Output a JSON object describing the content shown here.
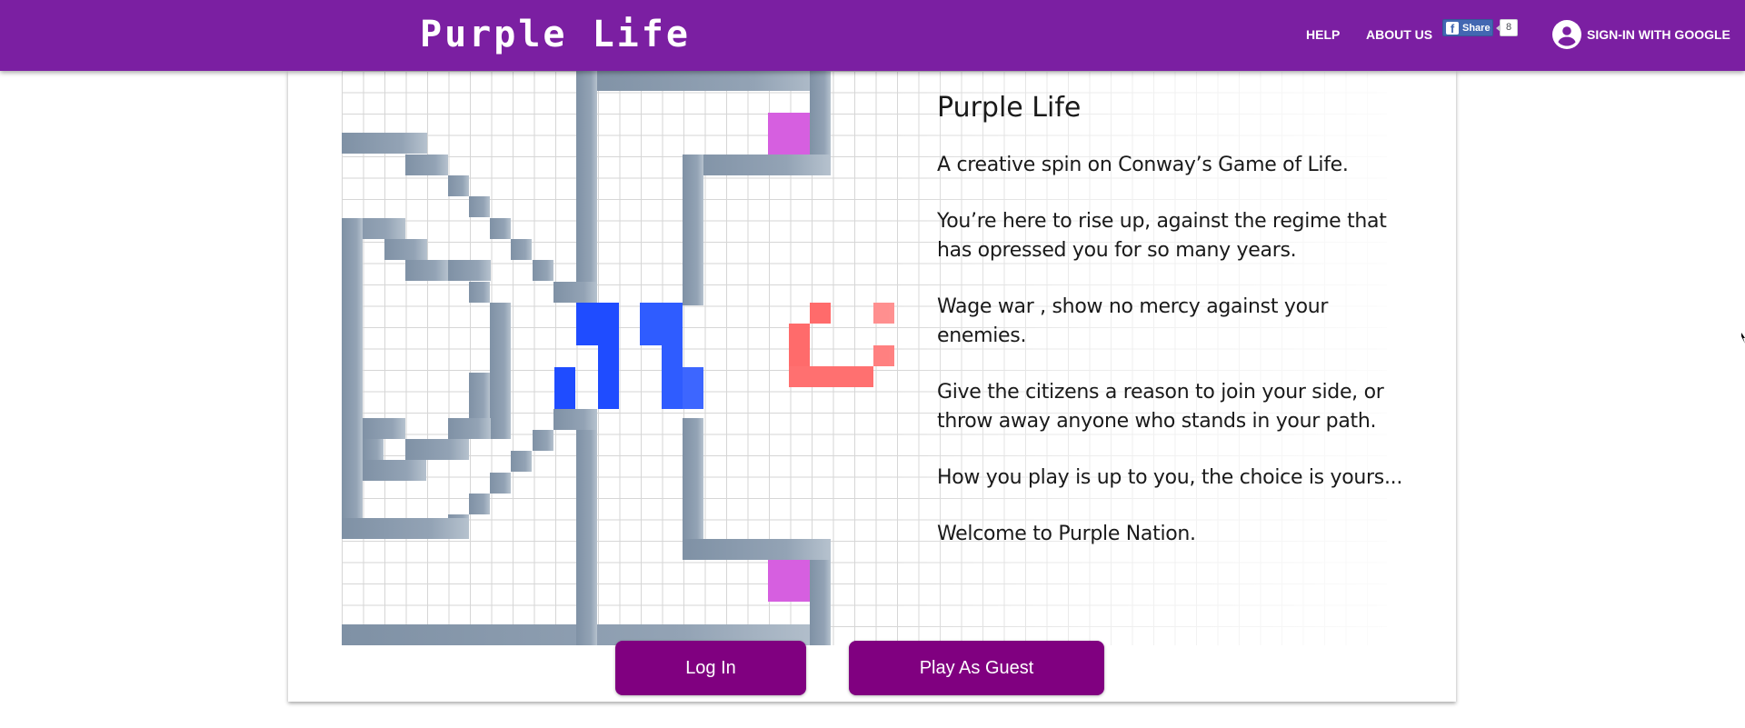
{
  "app": {
    "title": "Purple Life"
  },
  "nav": {
    "help": "HELP",
    "about": "ABOUT US",
    "share_label": "Share",
    "share_count": "8",
    "signin": "SIGN-IN WITH GOOGLE"
  },
  "intro": {
    "title": "Purple Life",
    "paragraphs": [
      "A creative spin on Conway’s Game of Life.",
      "You’re here to rise up, against the regime that has opressed you for so many years.",
      "Wage war , show no mercy against your enemies.",
      "Give the citizens a reason to join your side, or throw away anyone who stands in your path.",
      "How you play is up to you, the choice is yours...",
      "Welcome to Purple Nation."
    ]
  },
  "actions": {
    "login": "Log In",
    "guest": "Play As Guest"
  },
  "colors": {
    "header": "#7b1fa2",
    "button": "#800080",
    "wall": "#8a9bad",
    "blue_cells": "#1f4cff",
    "red_cells": "#ff6b6b",
    "pink_cells": "#d65fe0"
  }
}
